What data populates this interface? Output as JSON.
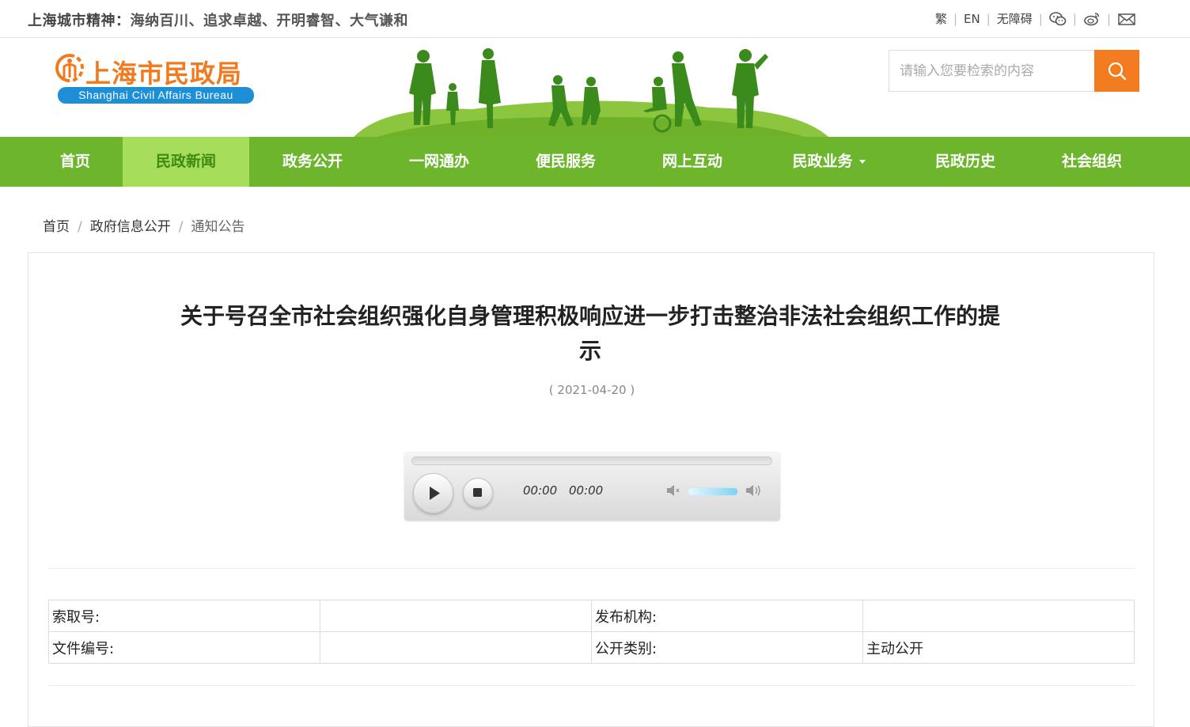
{
  "topbar": {
    "slogan_lead": "上海城市精神：",
    "slogan_body": "海纳百川、追求卓越、开明睿智、大气谦和",
    "links": {
      "traditional": "繁",
      "english": "EN",
      "accessibility": "无障碍"
    },
    "icons": [
      "wechat-icon",
      "weibo-icon",
      "mail-icon"
    ]
  },
  "header": {
    "logo_cn": "上海市民政局",
    "logo_en": "Shanghai  Civil  Affairs  Bureau",
    "search_placeholder": "请输入您要检索的内容",
    "colors": {
      "brand_orange": "#f47c20",
      "brand_blue": "#1d8fd6",
      "nav_green": "#6cb52d",
      "nav_active": "#a6dd5a"
    }
  },
  "nav": {
    "items": [
      {
        "label": "首页"
      },
      {
        "label": "民政新闻",
        "active": true
      },
      {
        "label": "政务公开"
      },
      {
        "label": "一网通办"
      },
      {
        "label": "便民服务"
      },
      {
        "label": "网上互动"
      },
      {
        "label": "民政业务",
        "dropdown": true
      },
      {
        "label": "民政历史"
      },
      {
        "label": "社会组织"
      }
    ]
  },
  "breadcrumb": [
    "首页",
    "政府信息公开",
    "通知公告"
  ],
  "article": {
    "title": "关于号召全市社会组织强化自身管理积极响应进一步打击整治非法社会组织工作的提示",
    "date": "( 2021-04-20 )"
  },
  "player": {
    "current_time": "00:00",
    "duration": "00:00",
    "progress": 0,
    "volume": 0.8
  },
  "meta_table": {
    "rows": [
      [
        "索取号:",
        "",
        "发布机构:",
        ""
      ],
      [
        "文件编号:",
        "",
        "公开类别:",
        "主动公开"
      ]
    ]
  }
}
